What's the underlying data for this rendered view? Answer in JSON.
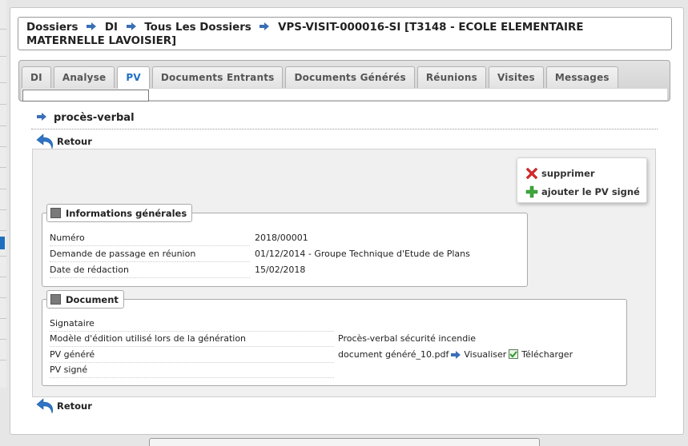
{
  "breadcrumb": {
    "items": [
      "Dossiers",
      "DI",
      "Tous Les Dossiers",
      "VPS-VISIT-000016-SI [T3148 - ECOLE ELEMENTAIRE MATERNELLE LAVOISIER]"
    ]
  },
  "tabs": [
    {
      "label": "DI"
    },
    {
      "label": "Analyse"
    },
    {
      "label": "PV",
      "active": true
    },
    {
      "label": "Documents Entrants"
    },
    {
      "label": "Documents Générés"
    },
    {
      "label": "Réunions"
    },
    {
      "label": "Visites"
    },
    {
      "label": "Messages"
    }
  ],
  "page": {
    "title": "procès-verbal",
    "back_label": "Retour"
  },
  "actions": {
    "delete": "supprimer",
    "add_signed": "ajouter le PV signé"
  },
  "general": {
    "legend": "Informations générales",
    "rows": [
      {
        "label": "Numéro",
        "value": "2018/00001"
      },
      {
        "label": "Demande de passage en réunion",
        "value": "01/12/2014 - Groupe Technique d'Etude de Plans"
      },
      {
        "label": "Date de rédaction",
        "value": "15/02/2018"
      }
    ]
  },
  "document": {
    "legend": "Document",
    "rows": [
      {
        "label": "Signataire",
        "value": ""
      },
      {
        "label": "Modèle d'édition utilisé lors de la génération",
        "value": "Procès-verbal sécurité incendie"
      },
      {
        "label": "PV généré",
        "value": "document généré_10.pdf",
        "view": "Visualiser",
        "download": "Télécharger"
      },
      {
        "label": "PV signé",
        "value": ""
      }
    ]
  },
  "colors": {
    "accent": "#1f6fc0",
    "arrow_icon": "#3a6fb7",
    "delete_icon": "#d8282a",
    "add_icon": "#3da83a"
  }
}
